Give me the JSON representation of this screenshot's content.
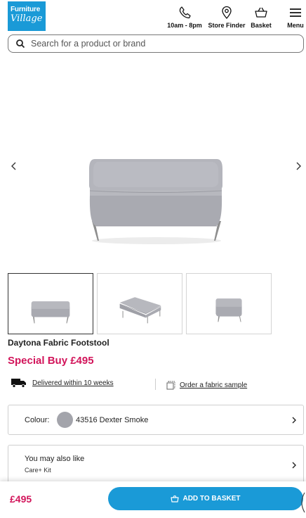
{
  "header": {
    "logo_line1": "Furniture",
    "logo_line2": "Village",
    "phone_label": "10am - 8pm",
    "store_label": "Store Finder",
    "basket_label": "Basket",
    "menu_label": "Menu"
  },
  "search": {
    "placeholder": "Search for a product or brand"
  },
  "gallery": {
    "thumbnail_count": 3,
    "active_index": 0
  },
  "product": {
    "title": "Daytona Fabric Footstool",
    "price_label": "Special Buy £495"
  },
  "delivery": {
    "text": "Delivered within 10 weeks"
  },
  "sample": {
    "text": "Order a fabric sample"
  },
  "colour": {
    "label": "Colour:",
    "value": "43516 Dexter Smoke",
    "swatch_color": "#a3a4ab"
  },
  "also_like": {
    "title": "You may also like",
    "subtitle": "Care+ Kit"
  },
  "sticky_bar": {
    "price": "£495",
    "button_label": "ADD TO BASKET"
  },
  "colors": {
    "brand_blue": "#1a9ad7",
    "price_pink": "#d2145a",
    "fabric_grey": "#a3a4ab"
  }
}
